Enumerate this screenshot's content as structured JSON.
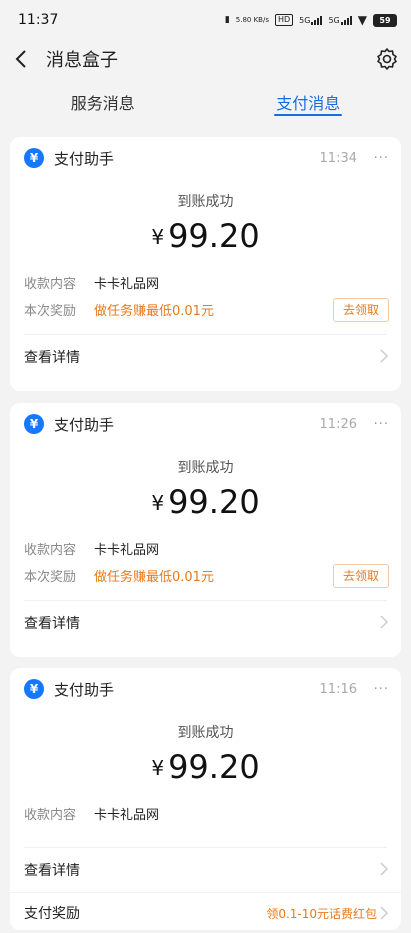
{
  "statusbar": {
    "time": "11:37",
    "speed": "5.80\nKB/s",
    "hd": "HD",
    "sim1": "5G",
    "sim2": "5G",
    "battery": "59"
  },
  "nav": {
    "title": "消息盒子",
    "back_icon": "chevron-left-icon",
    "settings_icon": "gear-icon"
  },
  "tabs": [
    {
      "label": "服务消息",
      "active": false
    },
    {
      "label": "支付消息",
      "active": true
    }
  ],
  "cards": [
    {
      "sender": "支付助手",
      "time": "11:34",
      "more": "···",
      "status": "到账成功",
      "currency": "¥",
      "amount": "99.20",
      "payee_label": "收款内容",
      "payee": "卡卡礼品网",
      "reward_label": "本次奖励",
      "reward": "做任务赚最低0.01元",
      "claim": "去领取",
      "detail": "查看详情"
    },
    {
      "sender": "支付助手",
      "time": "11:26",
      "more": "···",
      "status": "到账成功",
      "currency": "¥",
      "amount": "99.20",
      "payee_label": "收款内容",
      "payee": "卡卡礼品网",
      "reward_label": "本次奖励",
      "reward": "做任务赚最低0.01元",
      "claim": "去领取",
      "detail": "查看详情"
    },
    {
      "sender": "支付助手",
      "time": "11:16",
      "more": "···",
      "status": "到账成功",
      "currency": "¥",
      "amount": "99.20",
      "payee_label": "收款内容",
      "payee": "卡卡礼品网",
      "detail": "查看详情",
      "pay_reward_label": "支付奖励",
      "pay_reward": "领0.1-10元话费红包"
    }
  ],
  "colors": {
    "accent": "#1a6ddb",
    "reward": "#e87a1d",
    "alipay": "#1677ff"
  }
}
